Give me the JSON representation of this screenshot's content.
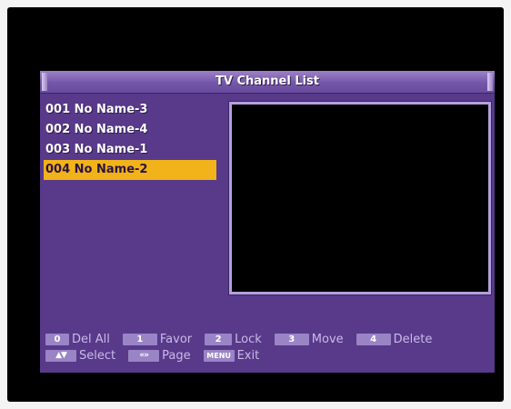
{
  "header": {
    "title": "TV Channel List"
  },
  "channels": [
    {
      "label": "001 No Name-3",
      "selected": false
    },
    {
      "label": "002 No Name-4",
      "selected": false
    },
    {
      "label": "003 No Name-1",
      "selected": false
    },
    {
      "label": "004 No Name-2",
      "selected": true
    }
  ],
  "footer": {
    "row1": [
      {
        "key": "0",
        "label": "Del All"
      },
      {
        "key": "1",
        "label": "Favor"
      },
      {
        "key": "2",
        "label": "Lock"
      },
      {
        "key": "3",
        "label": "Move"
      },
      {
        "key": "4",
        "label": "Delete"
      }
    ],
    "row2": [
      {
        "key_icon": "up-down-arrows-icon",
        "label": "Select"
      },
      {
        "key_icon": "page-left-right-icon",
        "label": "Page"
      },
      {
        "key": "MENU",
        "label": "Exit"
      }
    ]
  },
  "colors": {
    "panel": "#58398a",
    "highlight": "#f2b21a",
    "key": "#9a84c6",
    "preview_border": "#b3a0dc"
  }
}
